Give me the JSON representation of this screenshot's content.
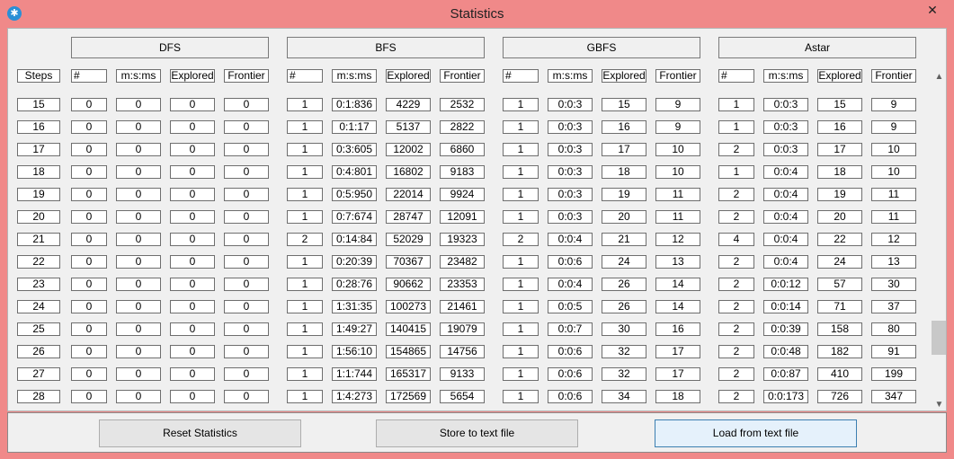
{
  "window": {
    "title": "Statistics",
    "close_label": "✕",
    "app_icon": "puzzle-icon"
  },
  "groups": [
    {
      "name": "DFS",
      "headers": [
        "#",
        "m:s:ms",
        "Explored",
        "Frontier"
      ]
    },
    {
      "name": "BFS",
      "headers": [
        "#",
        "m:s:ms",
        "Explored",
        "Frontier"
      ]
    },
    {
      "name": "GBFS",
      "headers": [
        "#",
        "m:s:ms",
        "Explored",
        "Frontier"
      ]
    },
    {
      "name": "Astar",
      "headers": [
        "#",
        "m:s:ms",
        "Explored",
        "Frontier"
      ]
    }
  ],
  "steps_header": "Steps",
  "rows": [
    {
      "steps": "15",
      "dfs": [
        "0",
        "0",
        "0",
        "0"
      ],
      "bfs": [
        "1",
        "0:1:836",
        "4229",
        "2532"
      ],
      "gbfs": [
        "1",
        "0:0:3",
        "15",
        "9"
      ],
      "astar": [
        "1",
        "0:0:3",
        "15",
        "9"
      ]
    },
    {
      "steps": "16",
      "dfs": [
        "0",
        "0",
        "0",
        "0"
      ],
      "bfs": [
        "1",
        "0:1:17",
        "5137",
        "2822"
      ],
      "gbfs": [
        "1",
        "0:0:3",
        "16",
        "9"
      ],
      "astar": [
        "1",
        "0:0:3",
        "16",
        "9"
      ]
    },
    {
      "steps": "17",
      "dfs": [
        "0",
        "0",
        "0",
        "0"
      ],
      "bfs": [
        "1",
        "0:3:605",
        "12002",
        "6860"
      ],
      "gbfs": [
        "1",
        "0:0:3",
        "17",
        "10"
      ],
      "astar": [
        "2",
        "0:0:3",
        "17",
        "10"
      ]
    },
    {
      "steps": "18",
      "dfs": [
        "0",
        "0",
        "0",
        "0"
      ],
      "bfs": [
        "1",
        "0:4:801",
        "16802",
        "9183"
      ],
      "gbfs": [
        "1",
        "0:0:3",
        "18",
        "10"
      ],
      "astar": [
        "1",
        "0:0:4",
        "18",
        "10"
      ]
    },
    {
      "steps": "19",
      "dfs": [
        "0",
        "0",
        "0",
        "0"
      ],
      "bfs": [
        "1",
        "0:5:950",
        "22014",
        "9924"
      ],
      "gbfs": [
        "1",
        "0:0:3",
        "19",
        "11"
      ],
      "astar": [
        "2",
        "0:0:4",
        "19",
        "11"
      ]
    },
    {
      "steps": "20",
      "dfs": [
        "0",
        "0",
        "0",
        "0"
      ],
      "bfs": [
        "1",
        "0:7:674",
        "28747",
        "12091"
      ],
      "gbfs": [
        "1",
        "0:0:3",
        "20",
        "11"
      ],
      "astar": [
        "2",
        "0:0:4",
        "20",
        "11"
      ]
    },
    {
      "steps": "21",
      "dfs": [
        "0",
        "0",
        "0",
        "0"
      ],
      "bfs": [
        "2",
        "0:14:84",
        "52029",
        "19323"
      ],
      "gbfs": [
        "2",
        "0:0:4",
        "21",
        "12"
      ],
      "astar": [
        "4",
        "0:0:4",
        "22",
        "12"
      ]
    },
    {
      "steps": "22",
      "dfs": [
        "0",
        "0",
        "0",
        "0"
      ],
      "bfs": [
        "1",
        "0:20:39",
        "70367",
        "23482"
      ],
      "gbfs": [
        "1",
        "0:0:6",
        "24",
        "13"
      ],
      "astar": [
        "2",
        "0:0:4",
        "24",
        "13"
      ]
    },
    {
      "steps": "23",
      "dfs": [
        "0",
        "0",
        "0",
        "0"
      ],
      "bfs": [
        "1",
        "0:28:76",
        "90662",
        "23353"
      ],
      "gbfs": [
        "1",
        "0:0:4",
        "26",
        "14"
      ],
      "astar": [
        "2",
        "0:0:12",
        "57",
        "30"
      ]
    },
    {
      "steps": "24",
      "dfs": [
        "0",
        "0",
        "0",
        "0"
      ],
      "bfs": [
        "1",
        "1:31:35",
        "100273",
        "21461"
      ],
      "gbfs": [
        "1",
        "0:0:5",
        "26",
        "14"
      ],
      "astar": [
        "2",
        "0:0:14",
        "71",
        "37"
      ]
    },
    {
      "steps": "25",
      "dfs": [
        "0",
        "0",
        "0",
        "0"
      ],
      "bfs": [
        "1",
        "1:49:27",
        "140415",
        "19079"
      ],
      "gbfs": [
        "1",
        "0:0:7",
        "30",
        "16"
      ],
      "astar": [
        "2",
        "0:0:39",
        "158",
        "80"
      ]
    },
    {
      "steps": "26",
      "dfs": [
        "0",
        "0",
        "0",
        "0"
      ],
      "bfs": [
        "1",
        "1:56:10",
        "154865",
        "14756"
      ],
      "gbfs": [
        "1",
        "0:0:6",
        "32",
        "17"
      ],
      "astar": [
        "2",
        "0:0:48",
        "182",
        "91"
      ]
    },
    {
      "steps": "27",
      "dfs": [
        "0",
        "0",
        "0",
        "0"
      ],
      "bfs": [
        "1",
        "1:1:744",
        "165317",
        "9133"
      ],
      "gbfs": [
        "1",
        "0:0:6",
        "32",
        "17"
      ],
      "astar": [
        "2",
        "0:0:87",
        "410",
        "199"
      ]
    },
    {
      "steps": "28",
      "dfs": [
        "0",
        "0",
        "0",
        "0"
      ],
      "bfs": [
        "1",
        "1:4:273",
        "172569",
        "5654"
      ],
      "gbfs": [
        "1",
        "0:0:6",
        "34",
        "18"
      ],
      "astar": [
        "2",
        "0:0:173",
        "726",
        "347"
      ]
    }
  ],
  "scrollbar": {
    "up": "▲",
    "down": "▼",
    "position_fraction": 0.74
  },
  "buttons": {
    "reset": "Reset Statistics",
    "store": "Store to text file",
    "load": "Load from text file"
  }
}
